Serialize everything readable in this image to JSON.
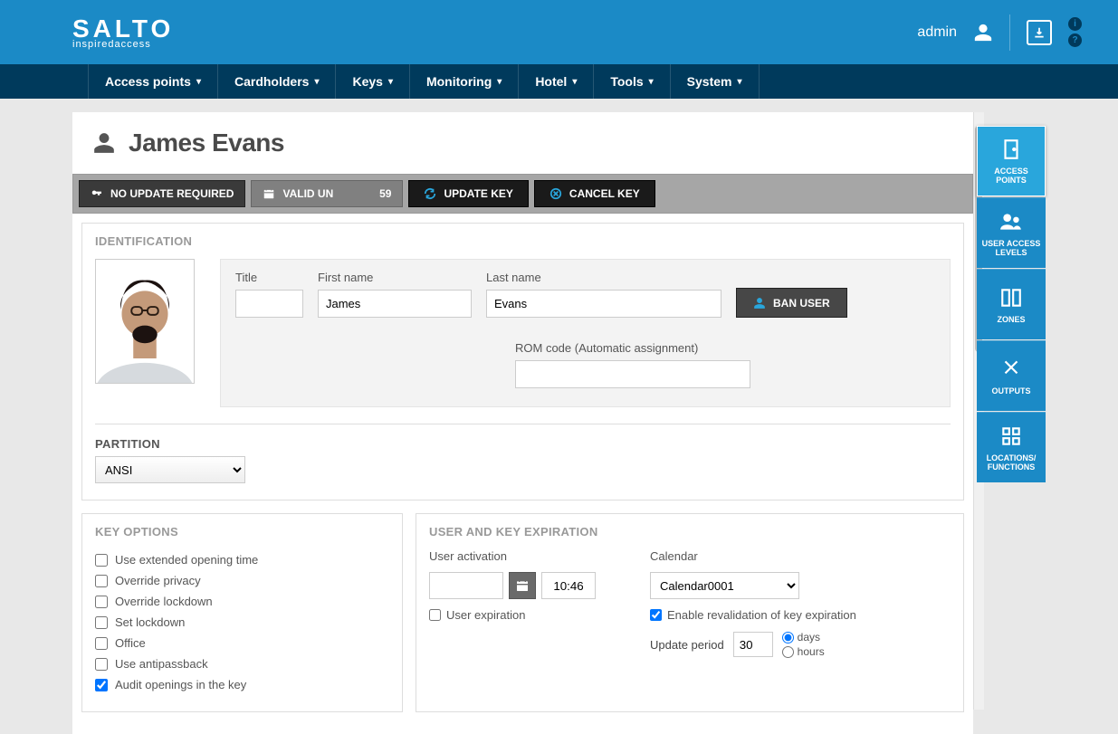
{
  "header": {
    "logo_main": "SALTO",
    "logo_sub": "inspiredaccess",
    "user": "admin"
  },
  "nav": [
    "Access points",
    "Cardholders",
    "Keys",
    "Monitoring",
    "Hotel",
    "Tools",
    "System"
  ],
  "page": {
    "title": "James Evans",
    "toolbar": {
      "no_update": "NO UPDATE REQUIRED",
      "valid_label": "VALID UN",
      "valid_num": "59",
      "update_key": "UPDATE KEY",
      "cancel_key": "CANCEL KEY"
    }
  },
  "identification": {
    "heading": "IDENTIFICATION",
    "title_label": "Title",
    "title_value": "",
    "first_label": "First name",
    "first_value": "James",
    "last_label": "Last name",
    "last_value": "Evans",
    "rom_label": "ROM code (Automatic assignment)",
    "rom_value": "",
    "ban_label": "BAN USER",
    "partition_heading": "PARTITION",
    "partition_value": "ANSI"
  },
  "key_options": {
    "heading": "KEY OPTIONS",
    "items": [
      {
        "label": "Use extended opening time",
        "checked": false
      },
      {
        "label": "Override privacy",
        "checked": false
      },
      {
        "label": "Override lockdown",
        "checked": false
      },
      {
        "label": "Set lockdown",
        "checked": false
      },
      {
        "label": "Office",
        "checked": false
      },
      {
        "label": "Use antipassback",
        "checked": false
      },
      {
        "label": "Audit openings in the key",
        "checked": true
      }
    ]
  },
  "expiration": {
    "heading": "USER AND KEY EXPIRATION",
    "activation_label": "User activation",
    "activation_time": "10:46",
    "user_exp_label": "User expiration",
    "user_exp_checked": false,
    "calendar_label": "Calendar",
    "calendar_value": "Calendar0001",
    "revalidation_label": "Enable revalidation of key expiration",
    "revalidation_checked": true,
    "period_label": "Update period",
    "period_value": "30",
    "unit_days": "days",
    "unit_hours": "hours",
    "unit_selected": "days"
  },
  "rail": [
    {
      "label": "ACCESS POINTS",
      "icon": "door"
    },
    {
      "label": "USER ACCESS LEVELS",
      "icon": "people"
    },
    {
      "label": "ZONES",
      "icon": "zones"
    },
    {
      "label": "OUTPUTS",
      "icon": "outputs"
    },
    {
      "label": "LOCATIONS/ FUNCTIONS",
      "icon": "locations"
    }
  ]
}
